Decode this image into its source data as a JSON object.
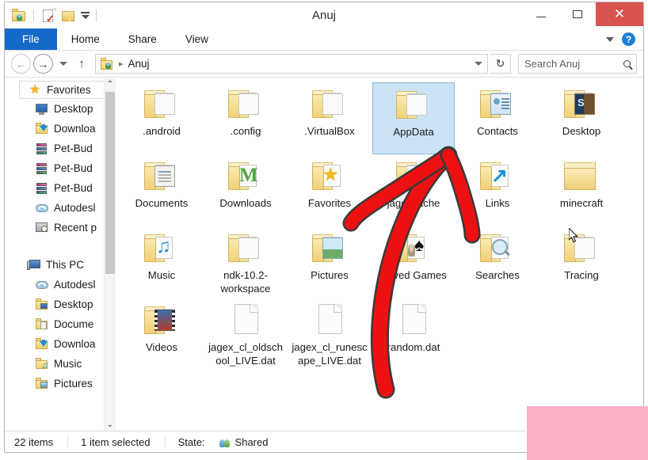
{
  "window": {
    "title": "Anuj",
    "quick_access": [
      {
        "name": "user-folder-icon",
        "label": "Anuj folder properties"
      },
      {
        "name": "properties-icon",
        "label": "Properties"
      },
      {
        "name": "new-folder-icon",
        "label": "New folder"
      },
      {
        "name": "customize-qat-icon",
        "label": "Customize Quick Access Toolbar"
      }
    ],
    "controls": {
      "minimize": "–",
      "maximize": "□",
      "close": "✕"
    }
  },
  "ribbon": {
    "tabs": [
      {
        "label": "File",
        "active": true
      },
      {
        "label": "Home",
        "active": false
      },
      {
        "label": "Share",
        "active": false
      },
      {
        "label": "View",
        "active": false
      }
    ],
    "expand_label": "∨",
    "help_label": "?"
  },
  "navbar": {
    "back_label": "←",
    "forward_label": "→",
    "recent_label": "▾",
    "up_label": "↑",
    "breadcrumb": [
      "Anuj"
    ],
    "breadcrumb_separator": "▸",
    "refresh_label": "↻",
    "search": {
      "value": "",
      "placeholder": "Search Anuj"
    }
  },
  "sidebar": {
    "groups": [
      {
        "label": "Favorites",
        "icon": "star-icon",
        "selected": true,
        "items": [
          {
            "label": "Desktop",
            "icon": "monitor-icon"
          },
          {
            "label": "Downloa",
            "icon": "downloads-folder-icon"
          },
          {
            "label": "Pet-Bud",
            "icon": "archive-icon"
          },
          {
            "label": "Pet-Bud",
            "icon": "archive-icon"
          },
          {
            "label": "Pet-Bud",
            "icon": "archive-icon"
          },
          {
            "label": "Autodesl",
            "icon": "cloud-icon"
          },
          {
            "label": "Recent p",
            "icon": "recent-places-icon"
          }
        ]
      },
      {
        "label": "This PC",
        "icon": "computer-icon",
        "selected": false,
        "items": [
          {
            "label": "Autodesl",
            "icon": "cloud-icon"
          },
          {
            "label": "Desktop",
            "icon": "desktop-folder-icon"
          },
          {
            "label": "Docume",
            "icon": "documents-folder-icon"
          },
          {
            "label": "Downloa",
            "icon": "downloads-folder-icon"
          },
          {
            "label": "Music",
            "icon": "music-folder-icon"
          },
          {
            "label": "Pictures",
            "icon": "pictures-folder-icon"
          }
        ]
      }
    ],
    "scroll_up_label": "⌃",
    "scroll_down_label": "⌄"
  },
  "content": {
    "items": [
      {
        "name": ".android",
        "type": "folder-open",
        "overlay": "ov-plain",
        "selected": false
      },
      {
        "name": ".config",
        "type": "folder-open",
        "overlay": "ov-plain",
        "selected": false
      },
      {
        "name": ".VirtualBox",
        "type": "folder-open",
        "overlay": "ov-plain",
        "selected": false
      },
      {
        "name": "AppData",
        "type": "folder-open",
        "overlay": "ov-plain",
        "selected": true
      },
      {
        "name": "Contacts",
        "type": "folder-open",
        "overlay": "ov-contacts",
        "selected": false
      },
      {
        "name": "Desktop",
        "type": "folder-open",
        "overlay": "ov-desk",
        "selected": false
      },
      {
        "name": "Documents",
        "type": "folder-open",
        "overlay": "ov-doc",
        "selected": false
      },
      {
        "name": "Downloads",
        "type": "folder-open",
        "overlay": "ov-dl",
        "selected": false
      },
      {
        "name": "Favorites",
        "type": "folder-open",
        "overlay": "ov-star",
        "selected": false
      },
      {
        "name": "jagexcache",
        "type": "folder-open",
        "overlay": "ov-plain",
        "selected": false
      },
      {
        "name": "Links",
        "type": "folder-open",
        "overlay": "ov-link",
        "selected": false
      },
      {
        "name": "minecraft",
        "type": "folder-closed",
        "overlay": "",
        "selected": false
      },
      {
        "name": "Music",
        "type": "folder-open",
        "overlay": "ov-music",
        "selected": false
      },
      {
        "name": "ndk-10.2-workspace",
        "type": "folder-open",
        "overlay": "ov-plain",
        "selected": false
      },
      {
        "name": "Pictures",
        "type": "folder-open",
        "overlay": "ov-pic",
        "selected": false
      },
      {
        "name": "Saved Games",
        "type": "folder-open",
        "overlay": "ov-games",
        "selected": false
      },
      {
        "name": "Searches",
        "type": "folder-open",
        "overlay": "ov-search",
        "selected": false
      },
      {
        "name": "Tracing",
        "type": "folder-open",
        "overlay": "ov-plain",
        "selected": false
      },
      {
        "name": "Videos",
        "type": "folder-open",
        "overlay": "ov-video",
        "selected": false
      },
      {
        "name": "jagex_cl_oldschool_LIVE.dat",
        "type": "file",
        "overlay": "",
        "selected": false
      },
      {
        "name": "jagex_cl_runescape_LIVE.dat",
        "type": "file",
        "overlay": "",
        "selected": false
      },
      {
        "name": "random.dat",
        "type": "file",
        "overlay": "",
        "selected": false
      }
    ]
  },
  "statusbar": {
    "item_count": "22 items",
    "selection": "1 item selected",
    "state_label": "State:",
    "state_value": "Shared"
  },
  "annotation": {
    "arrow_color": "#ee1111",
    "arrow_outline": "#3a3a3a",
    "description": "hand-drawn red arrow pointing to AppData"
  },
  "overlay": {
    "redaction_color": "#fcb2c4"
  }
}
